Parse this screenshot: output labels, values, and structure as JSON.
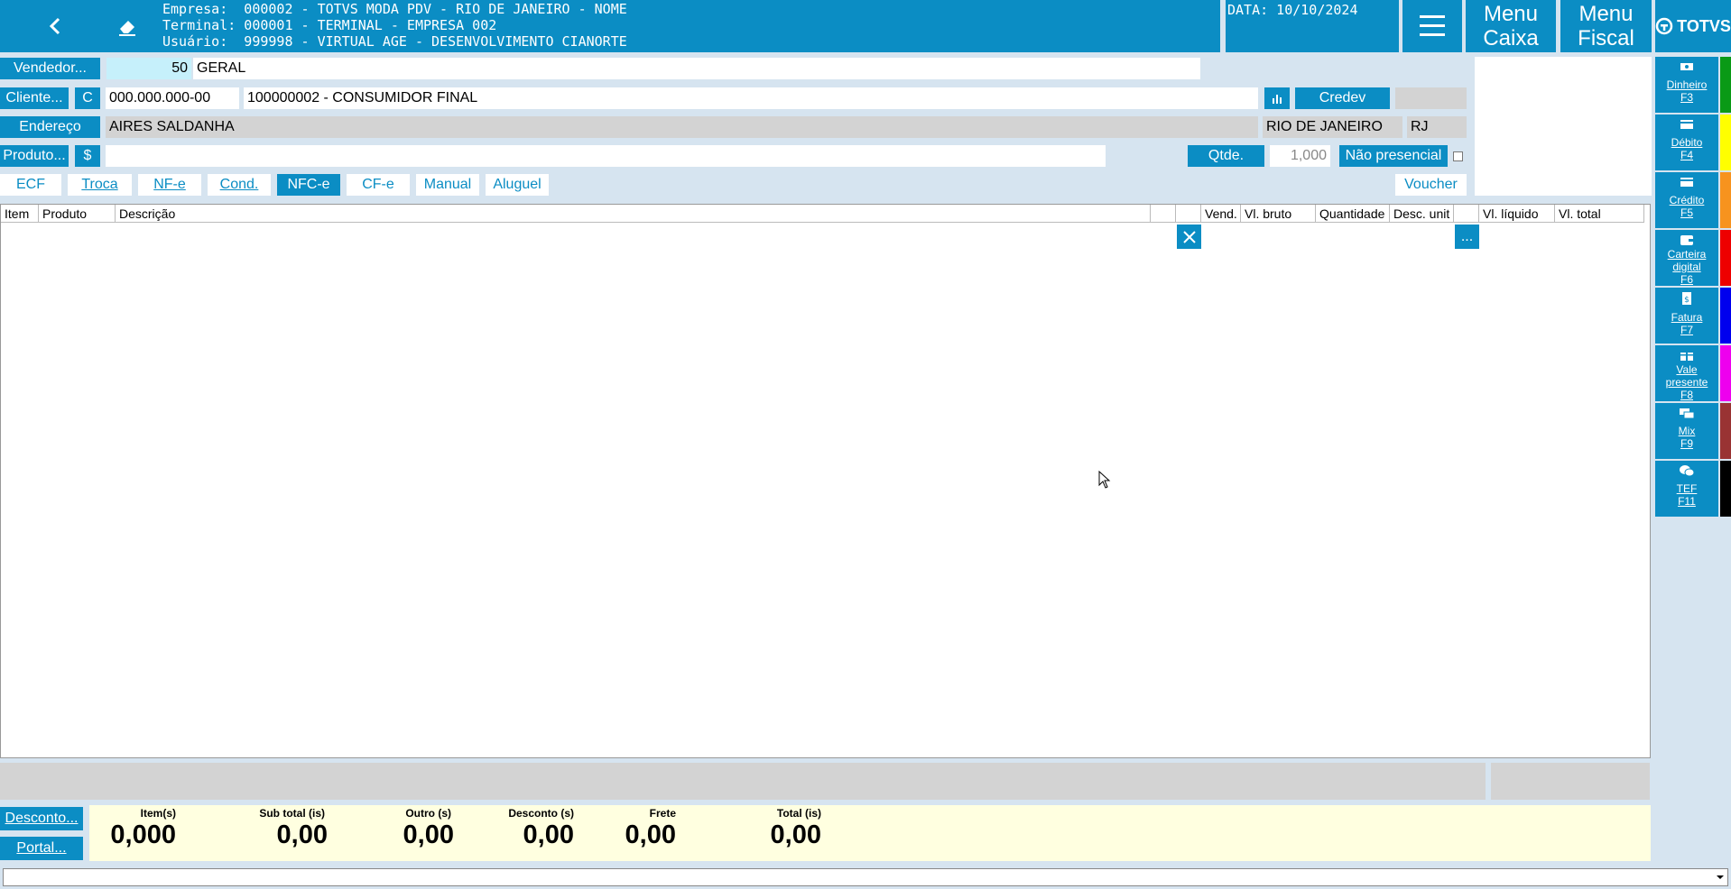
{
  "header": {
    "empresa": "Empresa:  000002 - TOTVS MODA PDV - RIO DE JANEIRO - NOME",
    "terminal": "Terminal: 000001 - TERMINAL - EMPRESA 002",
    "usuario": "Usuário:  999998 - VIRTUAL AGE - DESENVOLVIMENTO CIANORTE",
    "date": "DATA: 10/10/2024",
    "menu_caixa_1": "Menu",
    "menu_caixa_2": "Caixa",
    "menu_fiscal_1": "Menu",
    "menu_fiscal_2": "Fiscal",
    "logo": "TOTVS"
  },
  "form": {
    "vendedor_label": "Vendedor...",
    "vendedor_code": "50",
    "vendedor_name": "GERAL",
    "cliente_label": "Cliente...",
    "cliente_type": "C",
    "cliente_doc": "000.000.000-00",
    "cliente_name": "100000002 - CONSUMIDOR FINAL",
    "credev_label": "Credev",
    "endereco_label": "Endereço",
    "endereco_value": "AIRES SALDANHA",
    "cidade": "RIO DE JANEIRO",
    "uf": "RJ",
    "produto_label": "Produto...",
    "produto_dollar": "$",
    "qtde_label": "Qtde.",
    "qtde_value": "1,000",
    "nao_presencial_label": "Não presencial"
  },
  "tabs": [
    {
      "label": "ECF"
    },
    {
      "label": "Troca"
    },
    {
      "label": "NF-e"
    },
    {
      "label": "Cond."
    },
    {
      "label": "NFC-e"
    },
    {
      "label": "CF-e"
    },
    {
      "label": "Manual"
    },
    {
      "label": "Aluguel"
    }
  ],
  "voucher_label": "Voucher",
  "grid": {
    "columns": [
      "Item",
      "Produto",
      "Descrição",
      "",
      "",
      "Vend.",
      "Vl. bruto",
      "Quantidade",
      "Desc. unit",
      "",
      "Vl. líquido",
      "Vl. total"
    ],
    "more_label": "..."
  },
  "sidebar": [
    {
      "label": "Dinheiro",
      "key": "F3",
      "color": "#0a9a16"
    },
    {
      "label": "Débito",
      "key": "F4",
      "color": "#ffff00"
    },
    {
      "label": "Crédito",
      "key": "F5",
      "color": "#f7931e"
    },
    {
      "label": "Carteira digital",
      "key": "F6",
      "color": "#ee0000"
    },
    {
      "label": "Fatura",
      "key": "F7",
      "color": "#0000ee"
    },
    {
      "label": "Vale presente",
      "key": "F8",
      "color": "#ee00ee"
    },
    {
      "label": "Mix",
      "key": "F9",
      "color": "#993333"
    },
    {
      "label": "TEF",
      "key": "F11",
      "color": "#000000"
    }
  ],
  "footer": {
    "desconto_label": "Desconto...",
    "portal_label": "Portal...",
    "totals": [
      {
        "label": "Item(s)",
        "value": "0,000"
      },
      {
        "label": "Sub total (is)",
        "value": "0,00"
      },
      {
        "label": "Outro (s)",
        "value": "0,00"
      },
      {
        "label": "Desconto (s)",
        "value": "0,00"
      },
      {
        "label": "Frete",
        "value": "0,00"
      },
      {
        "label": "Total (is)",
        "value": "0,00"
      }
    ]
  },
  "colors": {
    "accent": "#0b8dc4",
    "background": "#d6e4f0",
    "totals_bg": "#ffffe0"
  }
}
